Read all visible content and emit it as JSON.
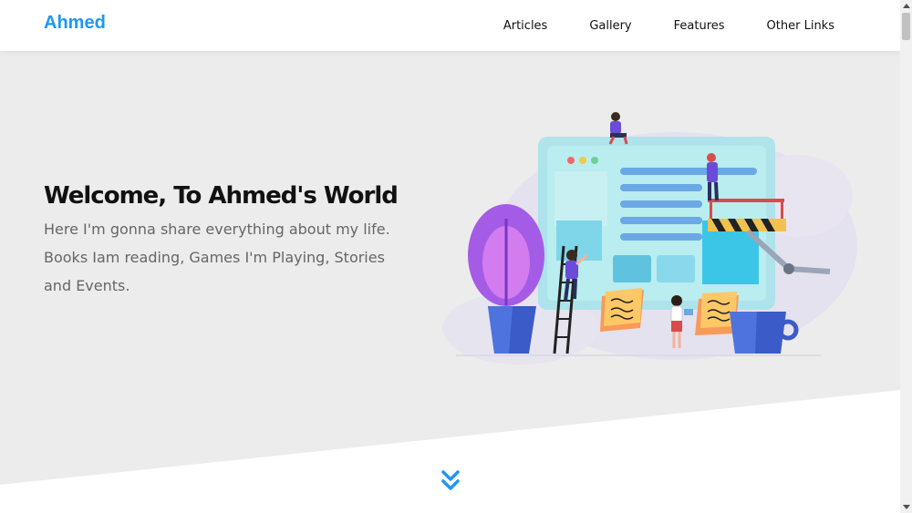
{
  "header": {
    "logo": "Ahmed",
    "nav": [
      "Articles",
      "Gallery",
      "Features",
      "Other Links"
    ]
  },
  "hero": {
    "title": "Welcome, To Ahmed's World",
    "text": "Here I'm gonna share everything about my life. Books Iam reading, Games I'm Playing, Stories and Events."
  },
  "icons": {
    "scroll_down": "double-chevron-down-icon",
    "illustration": "web-design-team-illustration"
  },
  "colors": {
    "accent": "#2196f3",
    "hero_background": "#ececec",
    "text_dark": "#111111",
    "text_muted": "#666666"
  }
}
